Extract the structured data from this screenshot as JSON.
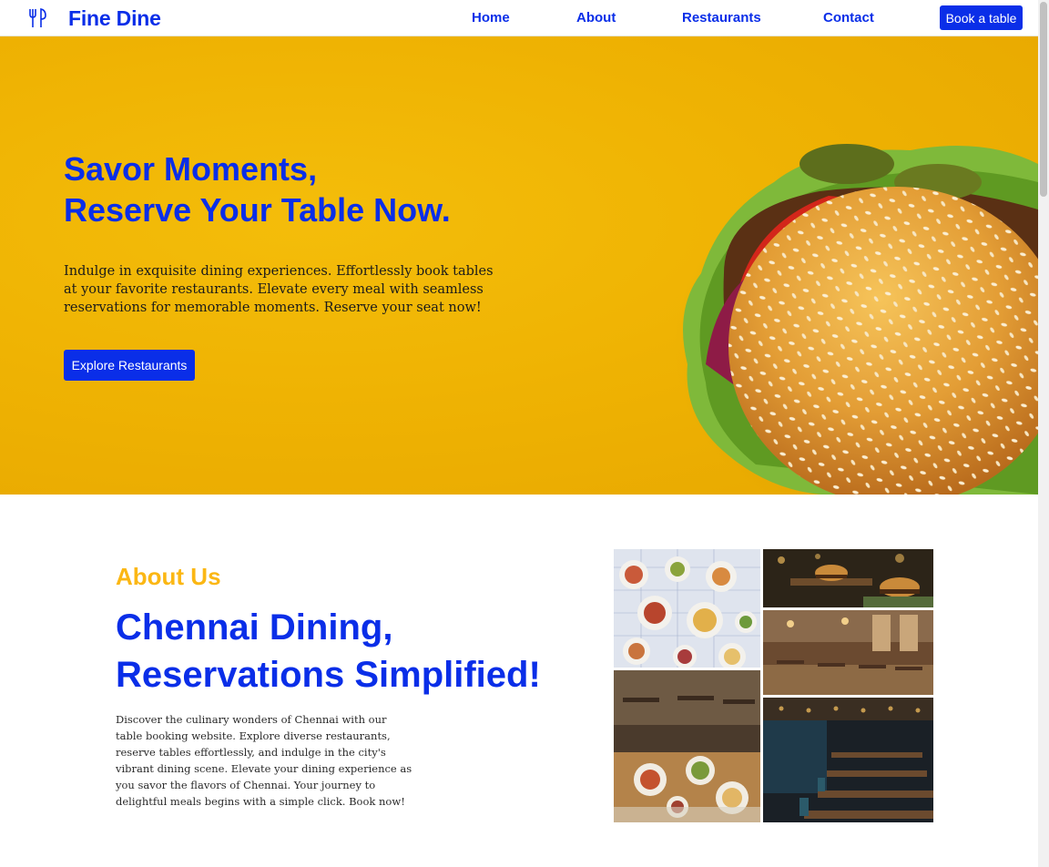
{
  "brand": {
    "name": "Fine Dine",
    "icon": "fork-knife-icon",
    "color": "#0a2ee8"
  },
  "nav": {
    "links": [
      "Home",
      "About",
      "Restaurants",
      "Contact"
    ],
    "cta": "Book a table"
  },
  "hero": {
    "title_line1": "Savor Moments,",
    "title_line2": "Reserve Your Table Now.",
    "description": "Indulge in exquisite dining experiences. Effortlessly book tables at your favorite restaurants. Elevate every meal with seamless reservations for memorable moments. Reserve your seat now!",
    "button": "Explore Restaurants",
    "background_color": "#efb303",
    "image": "burger-image"
  },
  "about": {
    "label": "About Us",
    "title_line1": "Chennai Dining,",
    "title_line2": "Reservations Simplified!",
    "description": "Discover the culinary wonders of Chennai with our table booking website. Explore diverse restaurants, reserve tables effortlessly, and indulge in the city's vibrant dining scene. Elevate your dining experience as you savor the flavors of Chennai. Your journey to delightful meals begins with a simple click. Book now!",
    "label_color": "#fbb714",
    "gallery": [
      "food-table-photo",
      "burger-tray-photo",
      "restaurant-interior-photo",
      "restaurant-table-food-photo",
      "dark-restaurant-photo"
    ]
  }
}
